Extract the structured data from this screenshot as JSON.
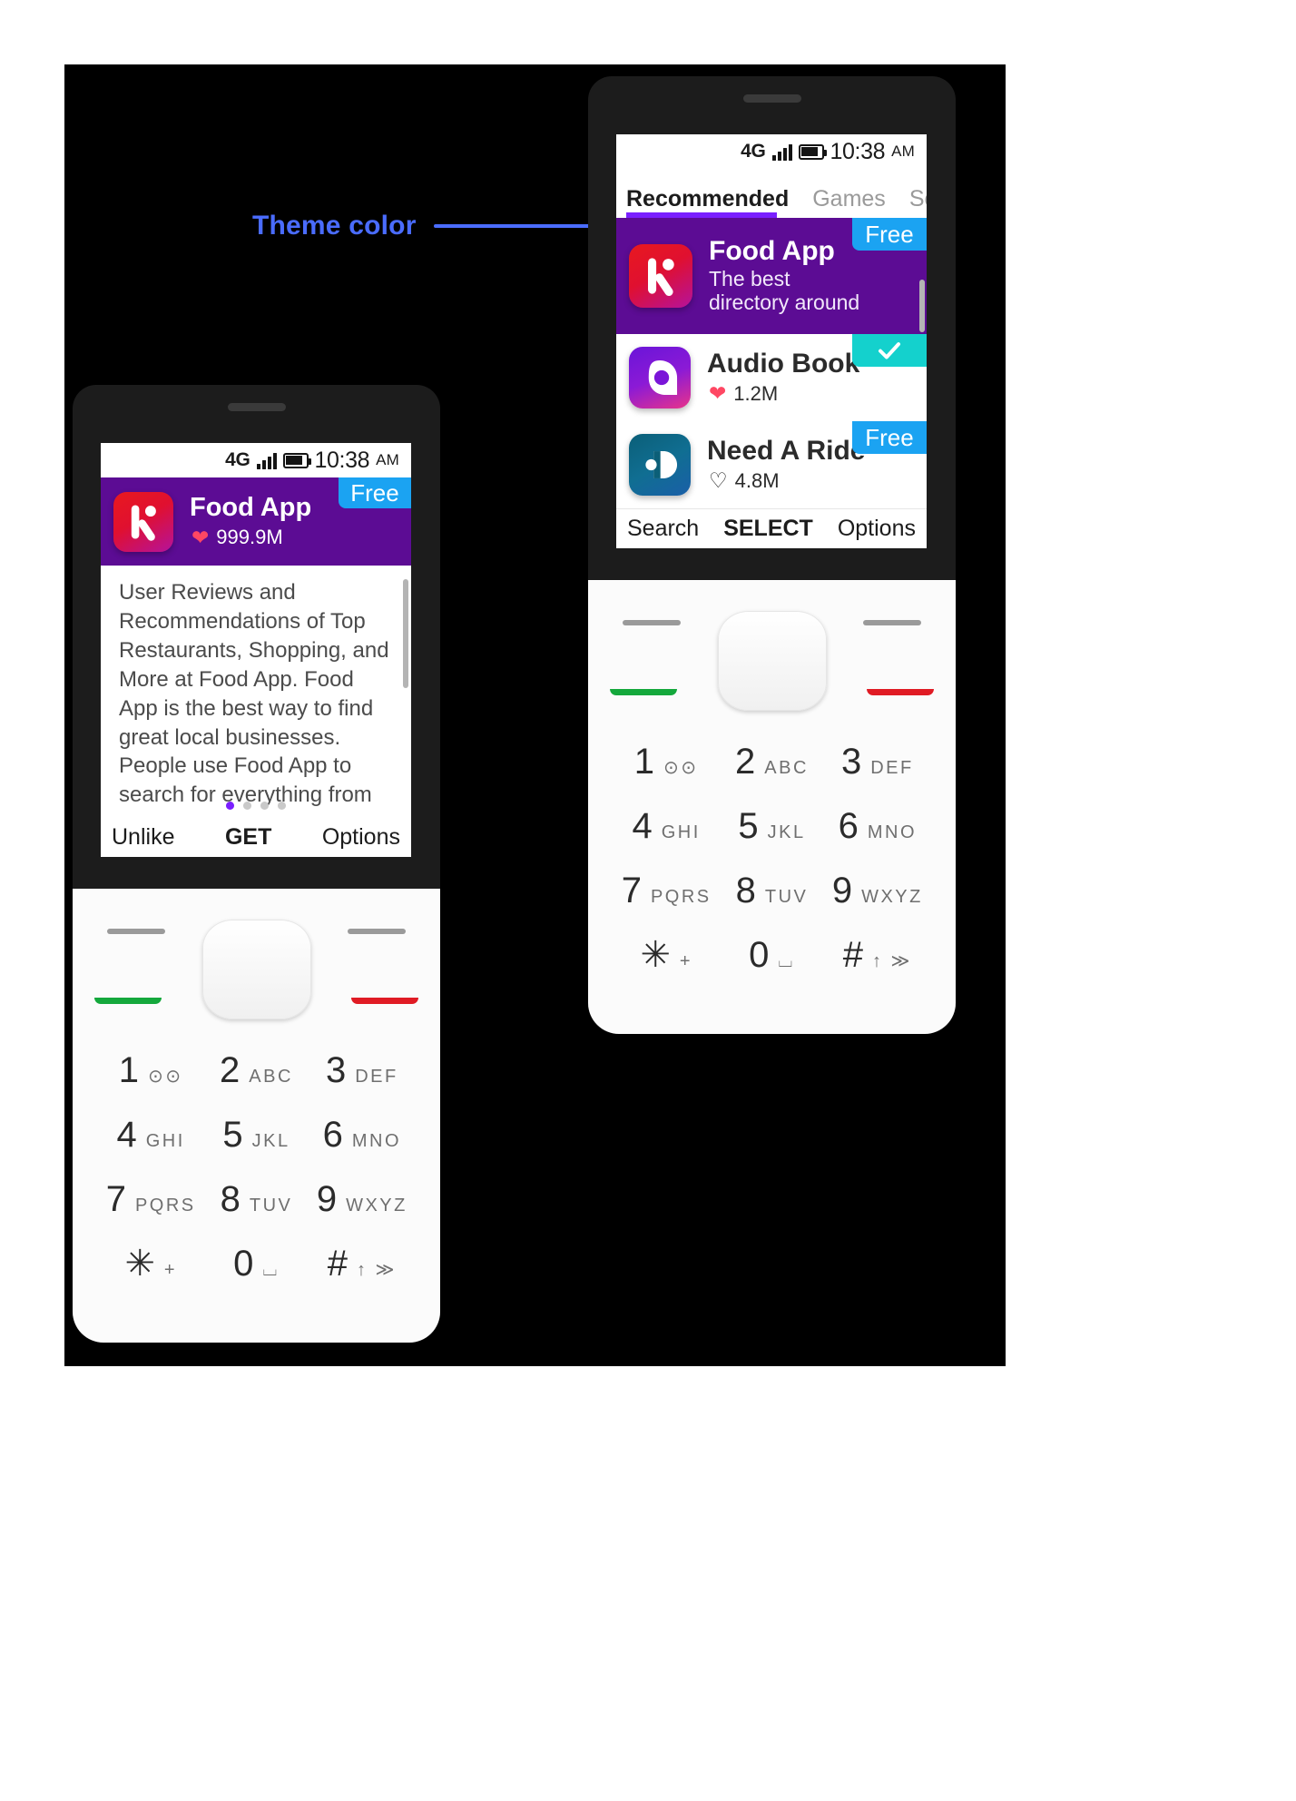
{
  "annotation": {
    "label": "Theme color",
    "color": "#4a6cff"
  },
  "theme": {
    "accent_purple": "#7a1fff",
    "featured_bg": "#5c0c94",
    "badge_free": "#1ba3f2",
    "badge_installed": "#14d1cd",
    "heart_red": "#ff4763"
  },
  "status_bar": {
    "network": "4G",
    "time": "10:38",
    "ampm": "AM",
    "signal_icon": "signal-bars-icon",
    "battery_icon": "battery-icon"
  },
  "phone_top": {
    "tabs": [
      {
        "label": "Recommended",
        "active": true
      },
      {
        "label": "Games",
        "active": false
      },
      {
        "label": "Social",
        "active": false
      }
    ],
    "rows": [
      {
        "name": "Food App",
        "subtitle": "The best directory around",
        "badge": "Free",
        "badge_type": "free",
        "icon": "food-app-icon",
        "featured": true
      },
      {
        "name": "Audio Book",
        "likes": "1.2M",
        "like_icon": "heart-filled-icon",
        "badge": "✓",
        "badge_type": "installed",
        "icon": "audio-book-icon",
        "featured": false
      },
      {
        "name": "Need A Ride",
        "likes": "4.8M",
        "like_icon": "heart-outline-icon",
        "badge": "Free",
        "badge_type": "free",
        "icon": "need-a-ride-icon",
        "featured": false
      }
    ],
    "soft_keys": {
      "left": "Search",
      "center": "SELECT",
      "right": "Options"
    }
  },
  "phone_left": {
    "header": {
      "name": "Food App",
      "likes": "999.9M",
      "like_icon": "heart-filled-icon",
      "badge": "Free",
      "icon": "food-app-icon"
    },
    "description": "User Reviews and Recommendations of Top Restaurants, Shopping, and More at Food App. Food App is the best way to find great local businesses. People use Food App to search for everything from",
    "pager": {
      "total": 4,
      "current": 1
    },
    "soft_keys": {
      "left": "Unlike",
      "center": "GET",
      "right": "Options"
    }
  },
  "keypad": {
    "keys": [
      {
        "num": "1",
        "sub": "⊙⊙"
      },
      {
        "num": "2",
        "sub": "ABC"
      },
      {
        "num": "3",
        "sub": "DEF"
      },
      {
        "num": "4",
        "sub": "GHI"
      },
      {
        "num": "5",
        "sub": "JKL"
      },
      {
        "num": "6",
        "sub": "MNO"
      },
      {
        "num": "7",
        "sub": "PQRS"
      },
      {
        "num": "8",
        "sub": "TUV"
      },
      {
        "num": "9",
        "sub": "WXYZ"
      },
      {
        "num": "✳",
        "sub": "+"
      },
      {
        "num": "0",
        "sub": "⌴"
      },
      {
        "num": "#",
        "sub": "↑ ≫"
      }
    ]
  }
}
